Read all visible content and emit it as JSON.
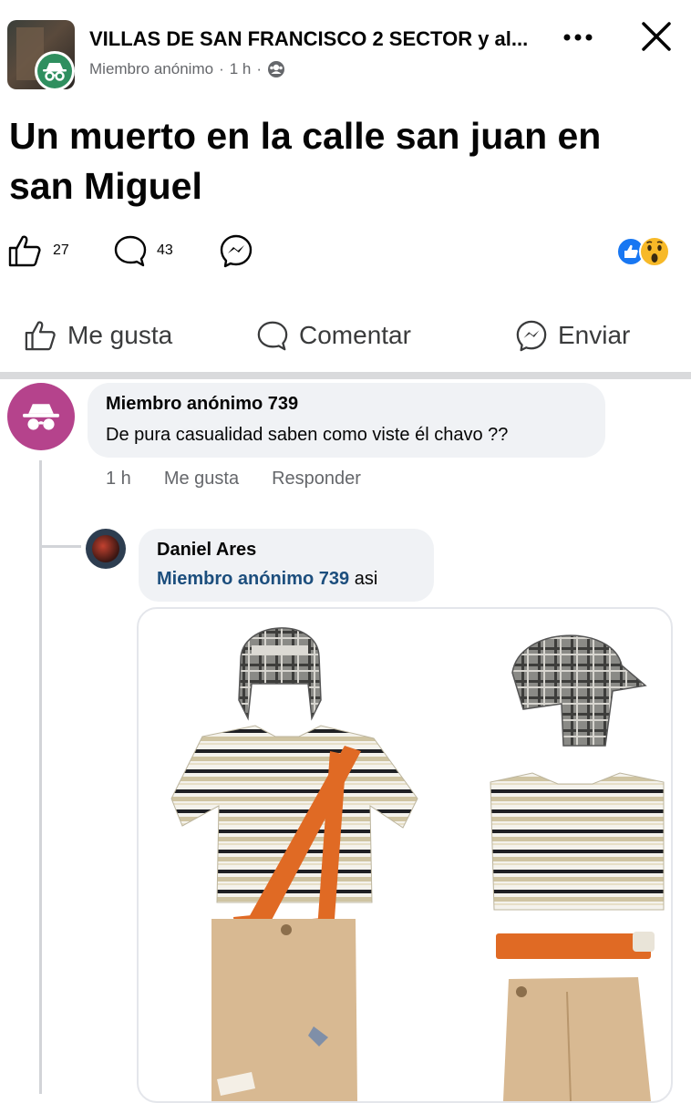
{
  "header": {
    "group_name": "VILLAS DE SAN FRANCISCO 2 SECTOR y al...",
    "author": "Miembro anónimo",
    "separator": "·",
    "time": "1 h",
    "more_icon": "more-horizontal-icon",
    "close_icon": "close-icon"
  },
  "post": {
    "text": "Un muerto en la calle san juan en san Miguel",
    "likes": "27",
    "comments": "43",
    "reaction_icons": [
      "like-reaction-icon",
      "wow-reaction-icon"
    ]
  },
  "actions": {
    "like": "Me gusta",
    "comment": "Comentar",
    "send": "Enviar"
  },
  "comments": [
    {
      "author": "Miembro anónimo 739",
      "text": "De pura casualidad saben como viste él chavo ??",
      "time": "1 h",
      "like": "Me gusta",
      "reply": "Responder",
      "replies": [
        {
          "author": "Daniel Ares",
          "mention": "Miembro anónimo 739",
          "text": "asi"
        }
      ]
    }
  ],
  "colors": {
    "primary_text": "#050505",
    "secondary_text": "#65676b",
    "bubble": "#f0f2f5",
    "mention": "#1c4e7d",
    "anon_badge": "#2f8f5f",
    "anon_avatar": "#b5438c",
    "like_blue": "#1877f2",
    "wow_yellow": "#f7b928"
  }
}
